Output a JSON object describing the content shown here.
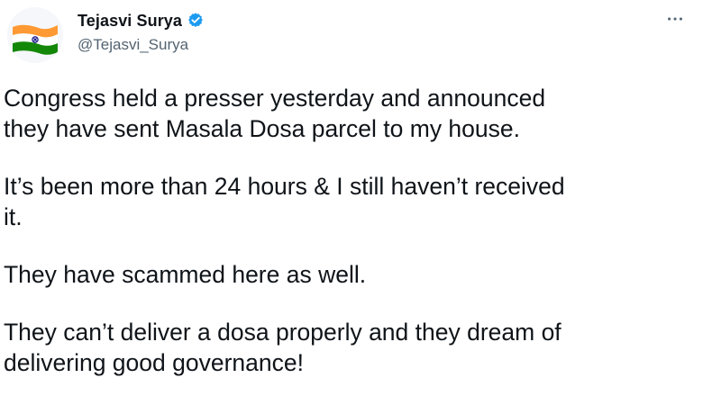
{
  "tweet": {
    "author": {
      "display_name": "Tejasvi Surya",
      "handle": "@Tejasvi_Surya",
      "verified": true,
      "avatar_icon": "india-flag-avatar"
    },
    "more_icon": "more-options-icon",
    "paragraphs": [
      "Congress held a presser yesterday and announced\nthey have sent Masala Dosa parcel to my house.",
      "It’s been more than 24 hours & I still haven’t received\nit.",
      "They have scammed here as well.",
      "They can’t deliver a dosa properly and they dream of\ndelivering good governance!"
    ]
  },
  "colors": {
    "text": "#0f1419",
    "secondary_text": "#536471",
    "verified_blue": "#1d9bf0",
    "flag_saffron": "#ff9933",
    "flag_green": "#138808",
    "flag_chakra": "#000080"
  }
}
